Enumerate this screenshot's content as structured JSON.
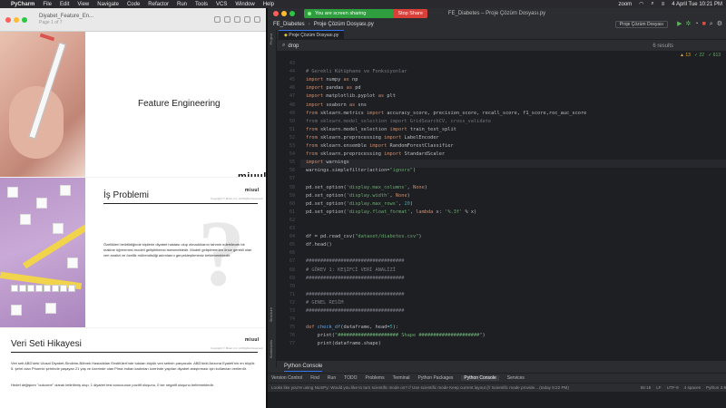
{
  "menubar": {
    "app": "PyCharm",
    "items": [
      "File",
      "Edit",
      "View",
      "Navigate",
      "Code",
      "Refactor",
      "Run",
      "Tools",
      "VCS",
      "Window",
      "Help"
    ],
    "right_app": "zoom",
    "clock": "4 April Tue 10:21 PM"
  },
  "pdf": {
    "title": "Diyabet_Feature_En...",
    "page": "Page 1 of 7",
    "slide1_title": "Feature Engineering",
    "brand": "miuul",
    "slide2_title": "İş Problemi",
    "slide2_text": "Özellikleri belirtildiğinde kişilerin diyabet hastası olup olmadıklarını tahmin edebilecek bir makine öğrenmesi modeli geliştirilmesi istenmektedir. Modeli geliştirmeden önce gerekli olan veri analizi ve özellik mühendisliği adımlarını gerçekleştirmeniz beklenmektedir.",
    "slide3_title": "Veri Seti Hikayesi",
    "slide3_text_1": "Veri seti ABD'deki Ulusal Diyabet-Sindirim-Böbrek Hastalıkları Enstitüleri'nde tutulan büyük veri setinin parçasıdır. ABD'deki Arizona Eyaleti'nin en büyük 5. şehri olan Phoenix şehrinde yaşayan 21 yaş ve üzerinde olan Pima Indian kadınları üzerinde yapılan diyabet araştırması için kullanılan verilerdir.",
    "slide3_text_2": "Hedef değişken \"outcome\" olarak belirtilmiş olup; 1 diyabet test sonucunun pozitif oluşunu, 0 ise negatif oluşunu belirtmektedir.",
    "copyright": "Copyright © Miuul, Inc. All Rights Reserved"
  },
  "share": {
    "text": "You are screen sharing",
    "stop": "Stop Share"
  },
  "ide": {
    "window_title": "FE_Diabetes – Proje Çözüm Dosyası.py",
    "project": "FE_Diabetes",
    "file": "Proje Çözüm Dosyası.py",
    "run_config": "Proje Çözüm Dosyası",
    "tab": "Proje Çözüm Dosyası.py",
    "search_query": "drop",
    "search_results": "6 results",
    "warnings": "▲ 13",
    "weak_warnings": "✓ 22",
    "typos": "✓ 613",
    "project_label": "Project",
    "structure_label": "Structure",
    "bookmarks_label": "Bookmarks",
    "console_tab": "Python Console",
    "tool_windows": [
      "Version Control",
      "Find",
      "Run",
      "TODO",
      "Problems",
      "Terminal",
      "Python Packages",
      "Python Console",
      "Services"
    ],
    "status_left": "Looks like you're using NumPy: Would you like to turn scientific mode on? // Use scientific mode   Keep current layout (// Scientific mode provide... (today 5:22 PM)",
    "status_right": [
      "55:18",
      "LF",
      "UTF-8",
      "4 spaces",
      "Python 3.9"
    ]
  },
  "code_lines": [
    {
      "n": "43",
      "t": ""
    },
    {
      "n": "44",
      "t": "# Gerekli Kütüphane ve Fonksiyonlar"
    },
    {
      "n": "45",
      "t": "import numpy as np"
    },
    {
      "n": "46",
      "t": "import pandas as pd"
    },
    {
      "n": "47",
      "t": "import matplotlib.pyplot as plt"
    },
    {
      "n": "48",
      "t": "import seaborn as sns"
    },
    {
      "n": "49",
      "t": "from sklearn.metrics import accuracy_score, precision_score, recall_score, f1_score,roc_auc_score"
    },
    {
      "n": "50",
      "t": "from sklearn.model_selection import GridSearchCV, cross_validate"
    },
    {
      "n": "51",
      "t": "from sklearn.model_selection import train_test_split"
    },
    {
      "n": "52",
      "t": "from sklearn.preprocessing import LabelEncoder"
    },
    {
      "n": "53",
      "t": "from sklearn.ensemble import RandomForestClassifier"
    },
    {
      "n": "54",
      "t": "from sklearn.preprocessing import StandardScaler"
    },
    {
      "n": "55",
      "t": "import warnings"
    },
    {
      "n": "56",
      "t": "warnings.simplefilter(action=\"ignore\")"
    },
    {
      "n": "57",
      "t": ""
    },
    {
      "n": "58",
      "t": "pd.set_option('display.max_columns', None)"
    },
    {
      "n": "59",
      "t": "pd.set_option('display.width', None)"
    },
    {
      "n": "60",
      "t": "pd.set_option('display.max_rows', 20)"
    },
    {
      "n": "61",
      "t": "pd.set_option('display.float_format', lambda x: '%.3f' % x)"
    },
    {
      "n": "62",
      "t": ""
    },
    {
      "n": "63",
      "t": ""
    },
    {
      "n": "64",
      "t": "df = pd.read_csv(\"dataset/diabetes.csv\")"
    },
    {
      "n": "65",
      "t": "df.head()"
    },
    {
      "n": "66",
      "t": ""
    },
    {
      "n": "67",
      "t": "##################################"
    },
    {
      "n": "68",
      "t": "# GÖREV 1: KEŞİFCİ VERİ ANALİZİ"
    },
    {
      "n": "69",
      "t": "##################################"
    },
    {
      "n": "70",
      "t": ""
    },
    {
      "n": "71",
      "t": "##################################"
    },
    {
      "n": "72",
      "t": "# GENEL RESİM"
    },
    {
      "n": "73",
      "t": "##################################"
    },
    {
      "n": "74",
      "t": ""
    },
    {
      "n": "75",
      "t": "def check_df(dataframe, head=5):"
    },
    {
      "n": "76",
      "t": "    print(\"##################### Shape #####################\")"
    },
    {
      "n": "77",
      "t": "    print(dataframe.shape)"
    }
  ],
  "colors": {
    "editor_bg": "#1e1f22",
    "keyword": "#cf8e6d",
    "string": "#6aab73",
    "comment": "#7a7e85",
    "share_green": "#2e9e3e",
    "stop_red": "#d9403a"
  }
}
